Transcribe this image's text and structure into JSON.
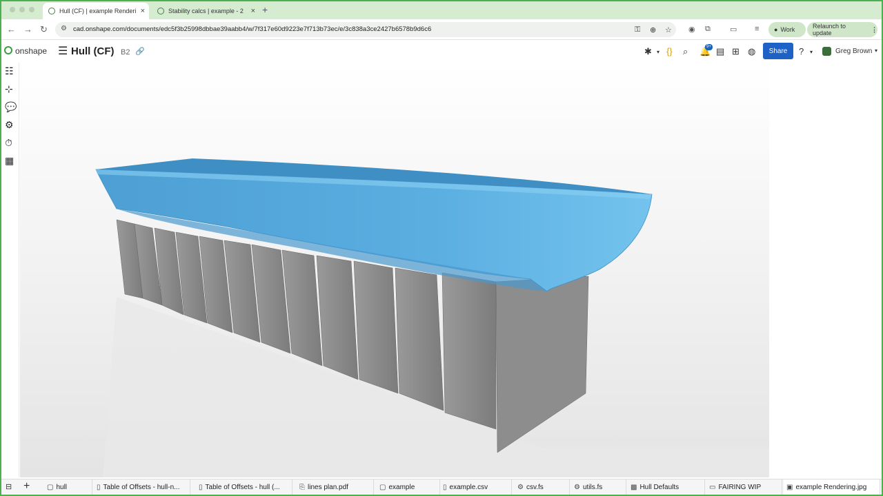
{
  "browser": {
    "tabs": [
      {
        "label": "Hull (CF) | example Rendering.j",
        "active": true
      },
      {
        "label": "Stability calcs | example - 2",
        "active": false
      }
    ],
    "url": "cad.onshape.com/documents/edc5f3b25998dbbae39aabb4/w/7f317e60d9223e7f713b73ec/e/3c838a3ce2427b6578b9d6c6",
    "profile_chip": "Work",
    "relaunch_label": "Relaunch to update"
  },
  "app": {
    "brand": "onshape",
    "document_title": "Hull (CF)",
    "workspace": "B2",
    "share_label": "Share",
    "notification_count": "9+",
    "user_name": "Greg Brown"
  },
  "bottom_tabs": [
    {
      "label": "hull",
      "icon": "part-studio-icon"
    },
    {
      "label": "Table of Offsets - hull-n...",
      "icon": "document-icon"
    },
    {
      "label": "Table of Offsets - hull (...",
      "icon": "document-icon"
    },
    {
      "label": "lines plan.pdf",
      "icon": "pdf-icon"
    },
    {
      "label": "example",
      "icon": "part-studio-icon"
    },
    {
      "label": "example.csv",
      "icon": "document-icon"
    },
    {
      "label": "csv.fs",
      "icon": "feature-studio-icon"
    },
    {
      "label": "utils.fs",
      "icon": "feature-studio-icon"
    },
    {
      "label": "Hull Defaults",
      "icon": "variable-studio-icon"
    },
    {
      "label": "FAIRING WIP",
      "icon": "folder-icon"
    },
    {
      "label": "example Rendering.jpg",
      "icon": "image-icon",
      "active": true
    }
  ],
  "colors": {
    "hull": "#5aa9dc",
    "frames": "#8a8a8a",
    "share": "#1f62c5",
    "frame_border": "#4caf50"
  }
}
